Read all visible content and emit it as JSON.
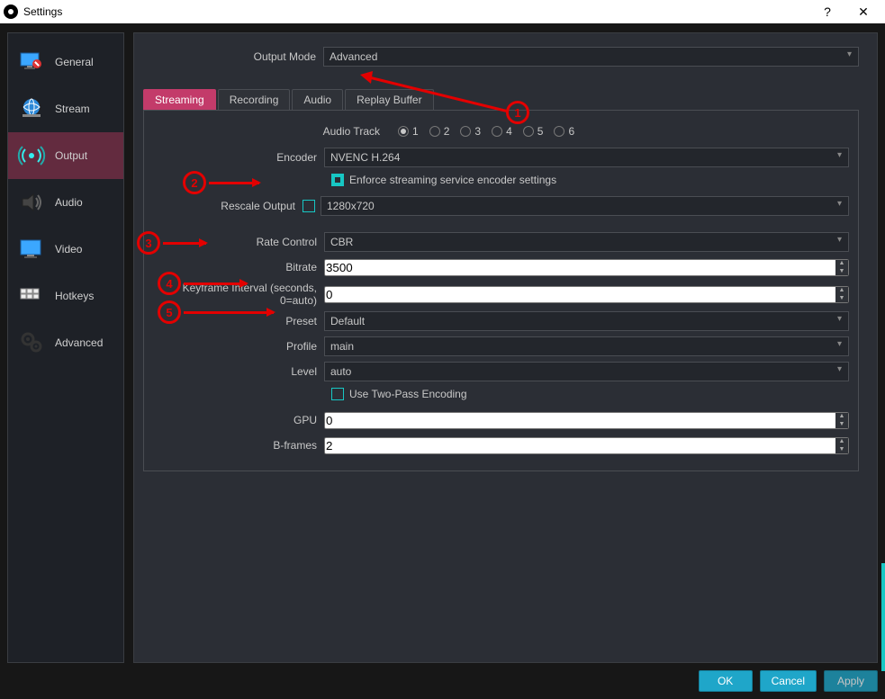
{
  "window": {
    "title": "Settings",
    "help_tooltip": "?",
    "close_tooltip": "✕"
  },
  "sidebar": {
    "items": [
      {
        "label": "General"
      },
      {
        "label": "Stream"
      },
      {
        "label": "Output"
      },
      {
        "label": "Audio"
      },
      {
        "label": "Video"
      },
      {
        "label": "Hotkeys"
      },
      {
        "label": "Advanced"
      }
    ],
    "active_index": 2
  },
  "output_mode": {
    "label": "Output Mode",
    "value": "Advanced"
  },
  "tabs": {
    "items": [
      "Streaming",
      "Recording",
      "Audio",
      "Replay Buffer"
    ],
    "active_index": 0
  },
  "audio_track": {
    "label": "Audio Track",
    "options": [
      "1",
      "2",
      "3",
      "4",
      "5",
      "6"
    ],
    "selected": "1"
  },
  "encoder": {
    "label": "Encoder",
    "value": "NVENC H.264"
  },
  "enforce": {
    "label": "Enforce streaming service encoder settings",
    "checked": true
  },
  "rescale": {
    "label": "Rescale Output",
    "checked": false,
    "value": "1280x720"
  },
  "rate_control": {
    "label": "Rate Control",
    "value": "CBR"
  },
  "bitrate": {
    "label": "Bitrate",
    "value": "3500"
  },
  "keyframe": {
    "label": "Keyframe Interval (seconds, 0=auto)",
    "value": "0"
  },
  "preset": {
    "label": "Preset",
    "value": "Default"
  },
  "profile": {
    "label": "Profile",
    "value": "main"
  },
  "level": {
    "label": "Level",
    "value": "auto"
  },
  "two_pass": {
    "label": "Use Two-Pass Encoding",
    "checked": false
  },
  "gpu": {
    "label": "GPU",
    "value": "0"
  },
  "bframes": {
    "label": "B-frames",
    "value": "2"
  },
  "buttons": {
    "ok": "OK",
    "cancel": "Cancel",
    "apply": "Apply"
  },
  "annotations": [
    "1",
    "2",
    "3",
    "4",
    "5"
  ]
}
